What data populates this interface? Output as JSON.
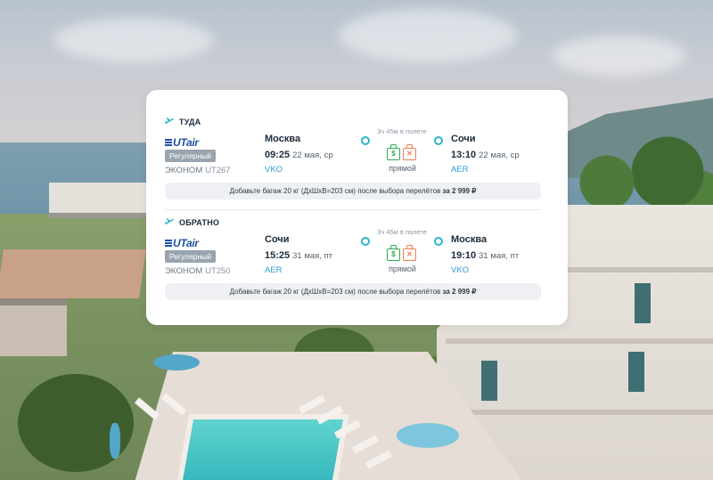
{
  "outbound": {
    "direction_label": "ТУДА",
    "airline_logo": "UTair",
    "ticket_type": "Регулярный",
    "fare_class": "ЭКОНОМ",
    "flight_number": "UT267",
    "departure": {
      "city": "Москва",
      "time": "09:25",
      "date": "22 мая, ср",
      "airport": "VKO"
    },
    "arrival": {
      "city": "Сочи",
      "time": "13:10",
      "date": "22 мая, ср",
      "airport": "AER"
    },
    "duration": "3ч 45м в полете",
    "stops": "прямой",
    "baggage_offer": "Добавьте багаж 20 кг (ДхШхВ=203 см) после выбора перелётов",
    "baggage_price": "за 2 999 ₽"
  },
  "return": {
    "direction_label": "ОБРАТНО",
    "airline_logo": "UTair",
    "ticket_type": "Регулярный",
    "fare_class": "ЭКОНОМ",
    "flight_number": "UT250",
    "departure": {
      "city": "Сочи",
      "time": "15:25",
      "date": "31 мая, пт",
      "airport": "AER"
    },
    "arrival": {
      "city": "Москва",
      "time": "19:10",
      "date": "31 мая, пт",
      "airport": "VKO"
    },
    "duration": "3ч 45м в полете",
    "stops": "прямой",
    "baggage_offer": "Добавьте багаж 20 кг (ДхШхВ=203 см) после выбора перелётов",
    "baggage_price": "за 2 999 ₽"
  },
  "icons": {
    "plane": "plane-icon",
    "hand_luggage_included": "hand-luggage-icon",
    "checked_baggage_excluded": "no-baggage-icon"
  },
  "colors": {
    "accent_teal": "#2ab5c9",
    "airport_blue": "#2e9bd6",
    "included_green": "#2faa55",
    "excluded_orange": "#f07d4a",
    "airline_blue": "#1f4fa3"
  }
}
